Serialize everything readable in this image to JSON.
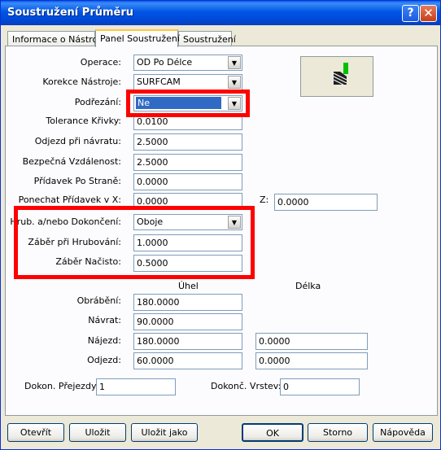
{
  "window": {
    "title": "Soustružení Průměru",
    "help_glyph": "?",
    "close_glyph": "✕"
  },
  "tabs": [
    "Informace o Nástroji",
    "Panel Soustružení",
    "Soustružení"
  ],
  "operace": {
    "label": "Operace:",
    "value": "OD Po Délce"
  },
  "korekce": {
    "label": "Korekce Nástroje:",
    "value": "SURFCAM"
  },
  "podrezani": {
    "label": "Podřezání:",
    "value": "Ne"
  },
  "tolerance": {
    "label": "Tolerance Křivky:",
    "value": "0.0100"
  },
  "odjezd": {
    "label": "Odjezd při návratu:",
    "value": "2.5000"
  },
  "bezpecna": {
    "label": "Bezpečná Vzdálenost:",
    "value": "2.5000"
  },
  "pridavek": {
    "label": "Přídavek Po Straně:",
    "value": "0.0000"
  },
  "ponechat": {
    "label": "Ponechat Přídavek v X:",
    "value": "0.0000"
  },
  "z": {
    "label": "Z:",
    "value": "0.0000"
  },
  "hrub": {
    "label": "Hrub. a/nebo Dokončení:",
    "value": "Oboje"
  },
  "zaber_hrub": {
    "label": "Záběr při Hrubování:",
    "value": "1.0000"
  },
  "zaber_nac": {
    "label": "Záběr Načisto:",
    "value": "0.5000"
  },
  "col_uhel": "Úhel",
  "col_delka": "Délka",
  "obrabeni": {
    "label": "Obrábění:",
    "uhel": "180.0000"
  },
  "navrat": {
    "label": "Návrat:",
    "uhel": "90.0000"
  },
  "najezd": {
    "label": "Nájezd:",
    "uhel": "180.0000",
    "delka": "0.0000"
  },
  "odjezd2": {
    "label": "Odjezd:",
    "uhel": "60.0000",
    "delka": "0.0000"
  },
  "dokon_prejezdy": {
    "label": "Dokon. Přejezdy:",
    "value": "1"
  },
  "dokonc_vrstev": {
    "label": "Dokonč. Vrstev:",
    "value": "0"
  },
  "buttons": {
    "otevrit": "Otevřít",
    "ulozit": "Uložit",
    "ulozit_jako": "Uložit jako",
    "ok": "OK",
    "storno": "Storno",
    "napoveda": "Nápověda"
  },
  "colors": {
    "highlight": "#ff0000",
    "title_bar": "#0055e5",
    "selection": "#316ac5"
  }
}
